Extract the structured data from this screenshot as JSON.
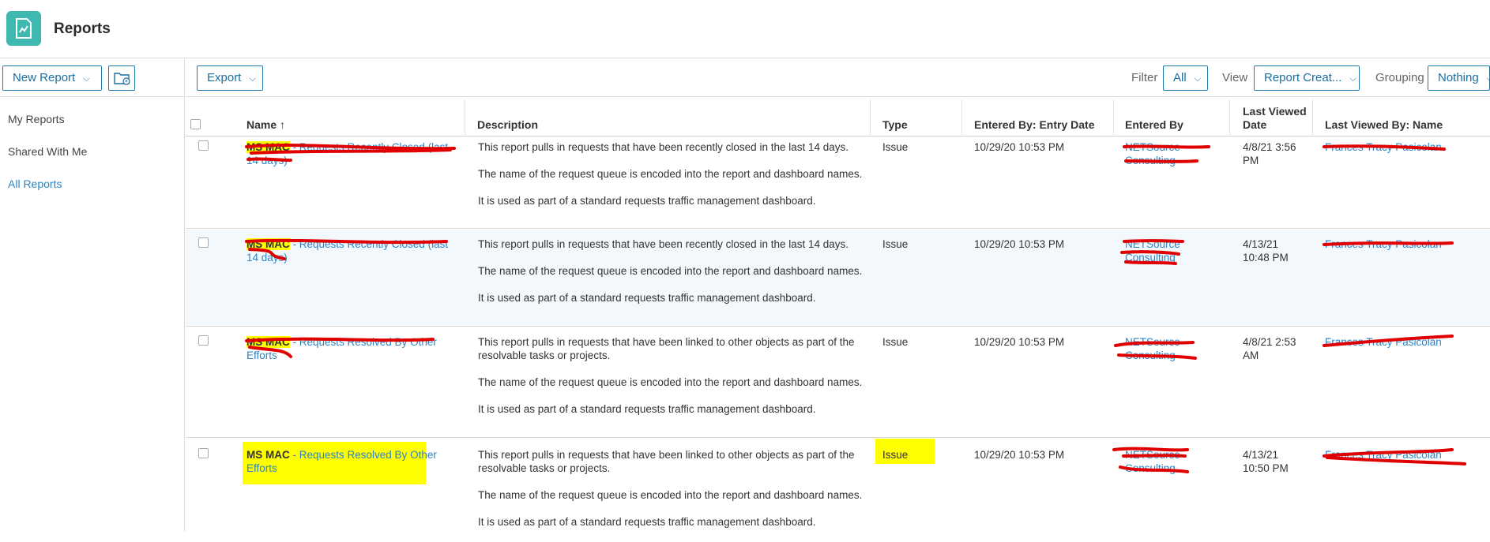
{
  "header": {
    "title": "Reports"
  },
  "sidebar": {
    "new_report_label": "New Report",
    "items": [
      {
        "label": "My Reports"
      },
      {
        "label": "Shared With Me"
      },
      {
        "label": "All Reports"
      }
    ]
  },
  "toolbar": {
    "export_label": "Export",
    "filter_label": "Filter",
    "filter_value": "All",
    "view_label": "View",
    "view_value": "Report Creat...",
    "grouping_label": "Grouping",
    "grouping_value": "Nothing"
  },
  "table": {
    "columns": {
      "name": "Name",
      "description": "Description",
      "type": "Type",
      "entry_date": "Entered By: Entry Date",
      "entered_by": "Entered By",
      "last_viewed_date": "Last Viewed Date",
      "last_viewed_by": "Last Viewed By: Name"
    },
    "rows": [
      {
        "name_prefix": "MS MAC",
        "name": " - Requests Recently Closed (last 14 days)",
        "desc": [
          "This report pulls in requests that have been recently closed in the last 14 days.",
          "The name of the request queue is encoded into the report and dashboard names.",
          "It is used as part of a standard requests traffic management dashboard."
        ],
        "type": "Issue",
        "entry_date": "10/29/20 10:53 PM",
        "entered_by": "NETSource Consulting",
        "last_viewed_date": "4/8/21 3:56 PM",
        "last_viewed_by": "Frances Tracy Pasicolan"
      },
      {
        "name_prefix": "MS MAC",
        "name": " - Requests Recently Closed (last 14 days)",
        "desc": [
          "This report pulls in requests that have been recently closed in the last 14 days.",
          "The name of the request queue is encoded into the report and dashboard names.",
          "It is used as part of a standard requests traffic management dashboard."
        ],
        "type": "Issue",
        "entry_date": "10/29/20 10:53 PM",
        "entered_by": "NETSource Consulting",
        "last_viewed_date": "4/13/21 10:48 PM",
        "last_viewed_by": "Frances Tracy Pasicolan"
      },
      {
        "name_prefix": "MS MAC",
        "name": " - Requests Resolved By Other Efforts",
        "desc": [
          "This report pulls in requests that have been linked to other objects as part of the resolvable tasks or projects.",
          "The name of the request queue is encoded into the report and dashboard names.",
          "It is used as part of a standard requests traffic management dashboard."
        ],
        "type": "Issue",
        "entry_date": "10/29/20 10:53 PM",
        "entered_by": "NETSource Consulting",
        "last_viewed_date": "4/8/21 2:53 AM",
        "last_viewed_by": "Frances Tracy Pasicolan"
      },
      {
        "name_prefix": "MS MAC",
        "name": " - Requests Resolved By Other Efforts",
        "desc": [
          "This report pulls in requests that have been linked to other objects as part of the resolvable tasks or projects.",
          "The name of the request queue is encoded into the report and dashboard names.",
          "It is used as part of a standard requests traffic management dashboard."
        ],
        "type": "Issue",
        "entry_date": "10/29/20 10:53 PM",
        "entered_by": "NETSource Consulting",
        "last_viewed_date": "4/13/21 10:50 PM",
        "last_viewed_by": "Frances Tracy Pasicolan"
      }
    ]
  },
  "colors": {
    "accent": "#2c84c4",
    "brand": "#3fb8b2",
    "highlight": "#ffff00",
    "redaction": "#e00000"
  }
}
